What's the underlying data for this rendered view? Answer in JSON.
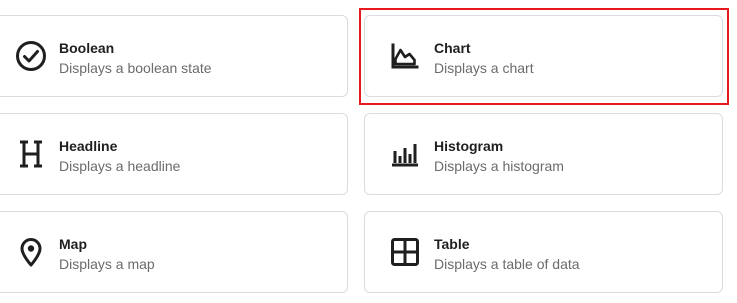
{
  "cards": [
    {
      "title": "Boolean",
      "description": "Displays a boolean state",
      "icon": "check-circle-icon"
    },
    {
      "title": "Chart",
      "description": "Displays a chart",
      "icon": "area-chart-icon"
    },
    {
      "title": "Headline",
      "description": "Displays a headline",
      "icon": "header-h-icon"
    },
    {
      "title": "Histogram",
      "description": "Displays a histogram",
      "icon": "bar-chart-icon"
    },
    {
      "title": "Map",
      "description": "Displays a map",
      "icon": "map-pin-icon"
    },
    {
      "title": "Table",
      "description": "Displays a table of data",
      "icon": "table-grid-icon"
    }
  ],
  "colors": {
    "highlight": "#e8191c",
    "card_border": "#dadce0",
    "title_text": "#1f1f1f",
    "description_text": "#6b6b6b"
  },
  "highlighted_card": "Chart"
}
